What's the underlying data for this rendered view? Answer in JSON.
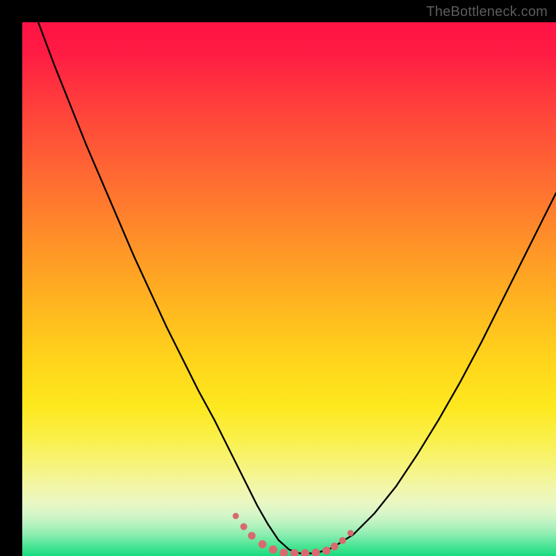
{
  "watermark": "TheBottleneck.com",
  "colors": {
    "background": "#000000",
    "curve": "#000000",
    "marker": "#d86a6f",
    "gradient_top": "#ff1345",
    "gradient_bottom": "#17db7e"
  },
  "chart_data": {
    "type": "line",
    "title": "",
    "xlabel": "",
    "ylabel": "",
    "xlim": [
      0,
      100
    ],
    "ylim": [
      0,
      100
    ],
    "grid": false,
    "legend": false,
    "series": [
      {
        "name": "bottleneck-curve",
        "x": [
          0,
          3,
          6,
          9,
          12,
          15,
          18,
          21,
          24,
          27,
          30,
          33,
          36,
          38,
          40,
          42,
          44,
          46,
          48,
          50,
          52,
          55,
          58,
          62,
          66,
          70,
          74,
          78,
          82,
          86,
          90,
          94,
          98,
          100
        ],
        "y": [
          108,
          100,
          92,
          84.5,
          77,
          70,
          63,
          56,
          49.5,
          43,
          37,
          31,
          25.5,
          21.5,
          17.5,
          13.5,
          9.5,
          6,
          3,
          1.2,
          0.5,
          0.5,
          1.5,
          4,
          8,
          13,
          19,
          25.5,
          32.5,
          40,
          48,
          56,
          64,
          68
        ]
      }
    ],
    "markers": {
      "name": "emphasis-dots",
      "color": "#d86a6f",
      "x": [
        40,
        41.5,
        43,
        45,
        47,
        49,
        51,
        53,
        55,
        57,
        58.5,
        60,
        61.5
      ],
      "y": [
        7.5,
        5.5,
        3.8,
        2.2,
        1.2,
        0.6,
        0.5,
        0.5,
        0.6,
        1.0,
        1.8,
        2.9,
        4.3
      ],
      "r": [
        4.5,
        5.0,
        5.5,
        5.8,
        6.0,
        6.0,
        6.0,
        6.0,
        6.0,
        5.8,
        5.5,
        5.0,
        4.5
      ]
    }
  }
}
